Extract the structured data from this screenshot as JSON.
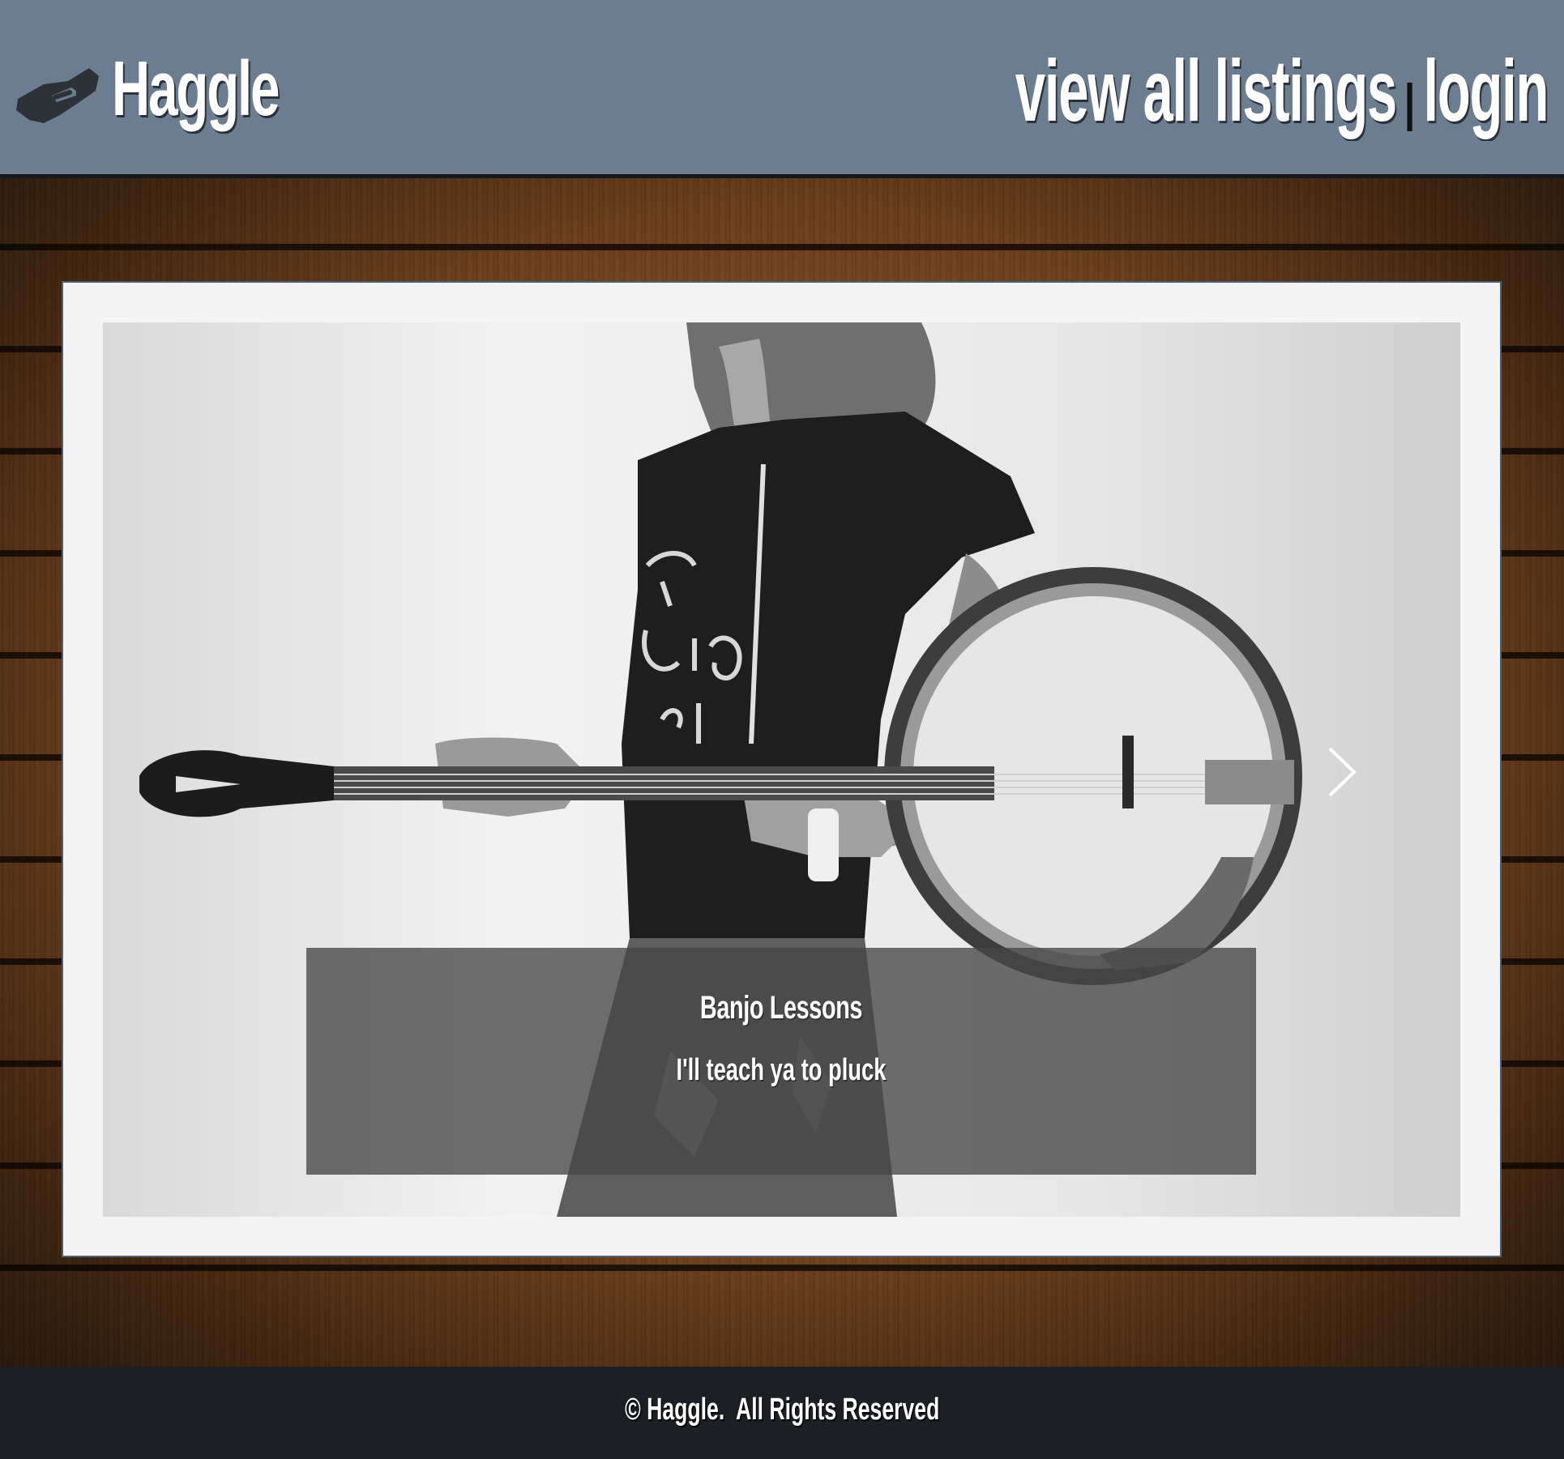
{
  "header": {
    "brand": "Haggle",
    "brand_icon": "handshake-icon",
    "nav": {
      "listings_label": "view all listings",
      "separator": "|",
      "login_label": "login"
    }
  },
  "colors": {
    "header_bg": "#6b7d91",
    "footer_bg": "#1c1f24",
    "card_bg": "#f4f4f4",
    "card_border": "#4c5f75",
    "caption_bg": "rgba(70,70,70,0.78)"
  },
  "carousel": {
    "slide": {
      "image_subject": "person holding banjo (black and white photo)",
      "title": "Banjo Lessons",
      "description": "I'll teach ya to pluck"
    },
    "next_icon": "chevron-right-icon"
  },
  "footer": {
    "text": "© Haggle.  All Rights Reserved"
  }
}
